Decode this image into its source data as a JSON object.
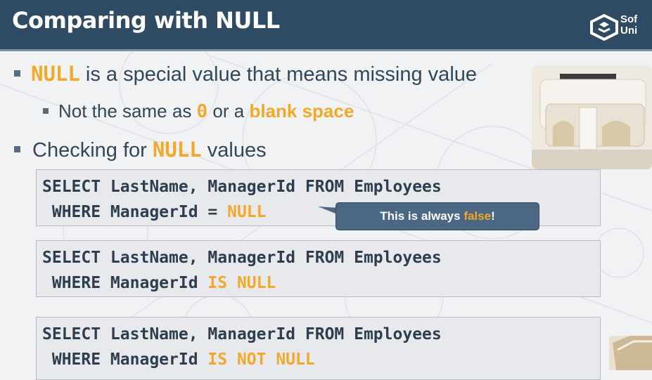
{
  "header": {
    "title": "Comparing with NULL",
    "logo_text_line1": "Sof",
    "logo_text_line2": "Uni"
  },
  "bullets": {
    "b1_kw": "NULL",
    "b1_rest": " is a special value that means missing value",
    "b2_pre": "Not the same as ",
    "b2_zero": "0",
    "b2_mid": " or a ",
    "b2_blank": "blank space",
    "b3_pre": "Checking for ",
    "b3_kw": "NULL",
    "b3_post": " values"
  },
  "code1": {
    "line1": "SELECT LastName, ManagerId FROM Employees",
    "line2_pre": " WHERE ManagerId = ",
    "line2_kw": "NULL"
  },
  "callout": {
    "pre": "This is always ",
    "kw": "false",
    "post": "!"
  },
  "code2": {
    "line1": "SELECT LastName, ManagerId FROM Employees",
    "line2_pre": " WHERE ManagerId ",
    "line2_kw": "IS NULL"
  },
  "code3": {
    "line1": "SELECT LastName, ManagerId FROM Employees",
    "line2_pre": " WHERE ManagerId ",
    "line2_kw": "IS NOT NULL"
  },
  "colors": {
    "header_bg": "#2f4a63",
    "accent": "#f3a829",
    "text": "#33475b"
  },
  "images": {
    "photo1": "toilet-paper-holder-photo",
    "photo2": "toilet-paper-photo"
  }
}
